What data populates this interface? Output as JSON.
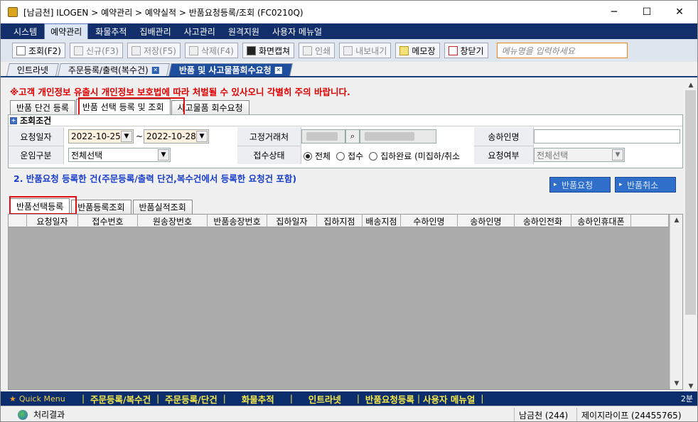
{
  "window": {
    "title": "[남금천] ILOGEN > 예약관리 > 예약실적 > 반품요청등록/조회 (FC0210Q)",
    "controls": {
      "minimize": "─",
      "maximize": "☐",
      "close": "✕"
    }
  },
  "menu": {
    "items": [
      "시스템",
      "예약관리",
      "화물추적",
      "집배관리",
      "사고관리",
      "원격지원",
      "사용자 메뉴얼"
    ],
    "active": "예약관리"
  },
  "toolbar": {
    "search": "조회(F2)",
    "new": "신규(F3)",
    "save": "저장(F5)",
    "delete": "삭제(F4)",
    "capture": "화면캡쳐",
    "print": "인쇄",
    "export": "내보내기",
    "memo": "메모장",
    "close_window": "창닫기",
    "menu_search_placeholder": "메뉴명을 입력하세요"
  },
  "doc_tabs": [
    {
      "label": "인트라넷",
      "closable": false
    },
    {
      "label": "주문등록/출력(복수건)",
      "closable": true
    },
    {
      "label": "반품 및 사고물품회수요청",
      "closable": true,
      "active": true
    }
  ],
  "warning": "※고객 개인정보 유출시 개인정보 보호법에 따라 처벌될 수 있사오니 각별히 주의 바랍니다.",
  "sub_tabs": [
    "반품 단건 등록",
    "반품 선택 등록 및 조회",
    "사고물품 회수요청"
  ],
  "conditions": {
    "header": "조회조건",
    "request_date_label": "요청일자",
    "date_from": "2022-10-25",
    "date_sep": "~",
    "date_to": "2022-10-28",
    "fixed_client_label": "고정거래처",
    "receiver_label": "송하인명",
    "fare_type_label": "운임구분",
    "fare_type_value": "전체선택",
    "receipt_status_label": "접수상태",
    "receipt_options": [
      "전체",
      "접수",
      "집하완료 (미집하/취소"
    ],
    "request_flag_label": "요청여부",
    "request_flag_value": "전체선택"
  },
  "section2": {
    "title": "2. 반품요청 등록한 건(주문등록/출력 단건,복수건에서 등록한 요청건 포함)",
    "request_button": "반품요청",
    "cancel_button": "반품취소"
  },
  "grid_tabs": [
    "반품선택등록",
    "반품등록조회",
    "반품실적조회"
  ],
  "grid": {
    "columns": [
      "요청일자",
      "접수번호",
      "원송장번호",
      "반품송장번호",
      "집하일자",
      "집하지점",
      "배송지점",
      "수하인명",
      "송하인명",
      "송하인전화",
      "송하인휴대폰"
    ]
  },
  "quick_menu": {
    "label": "Quick Menu",
    "links": [
      "주문등록/복수건",
      "주문등록/단건",
      "화물추적",
      "인트라넷",
      "반품요청등록",
      "사용자 메뉴얼"
    ],
    "time": "2분"
  },
  "status": {
    "result_label": "처리결과",
    "user": "남금천 (244)",
    "company": "제이지라이프 (24455765)"
  }
}
